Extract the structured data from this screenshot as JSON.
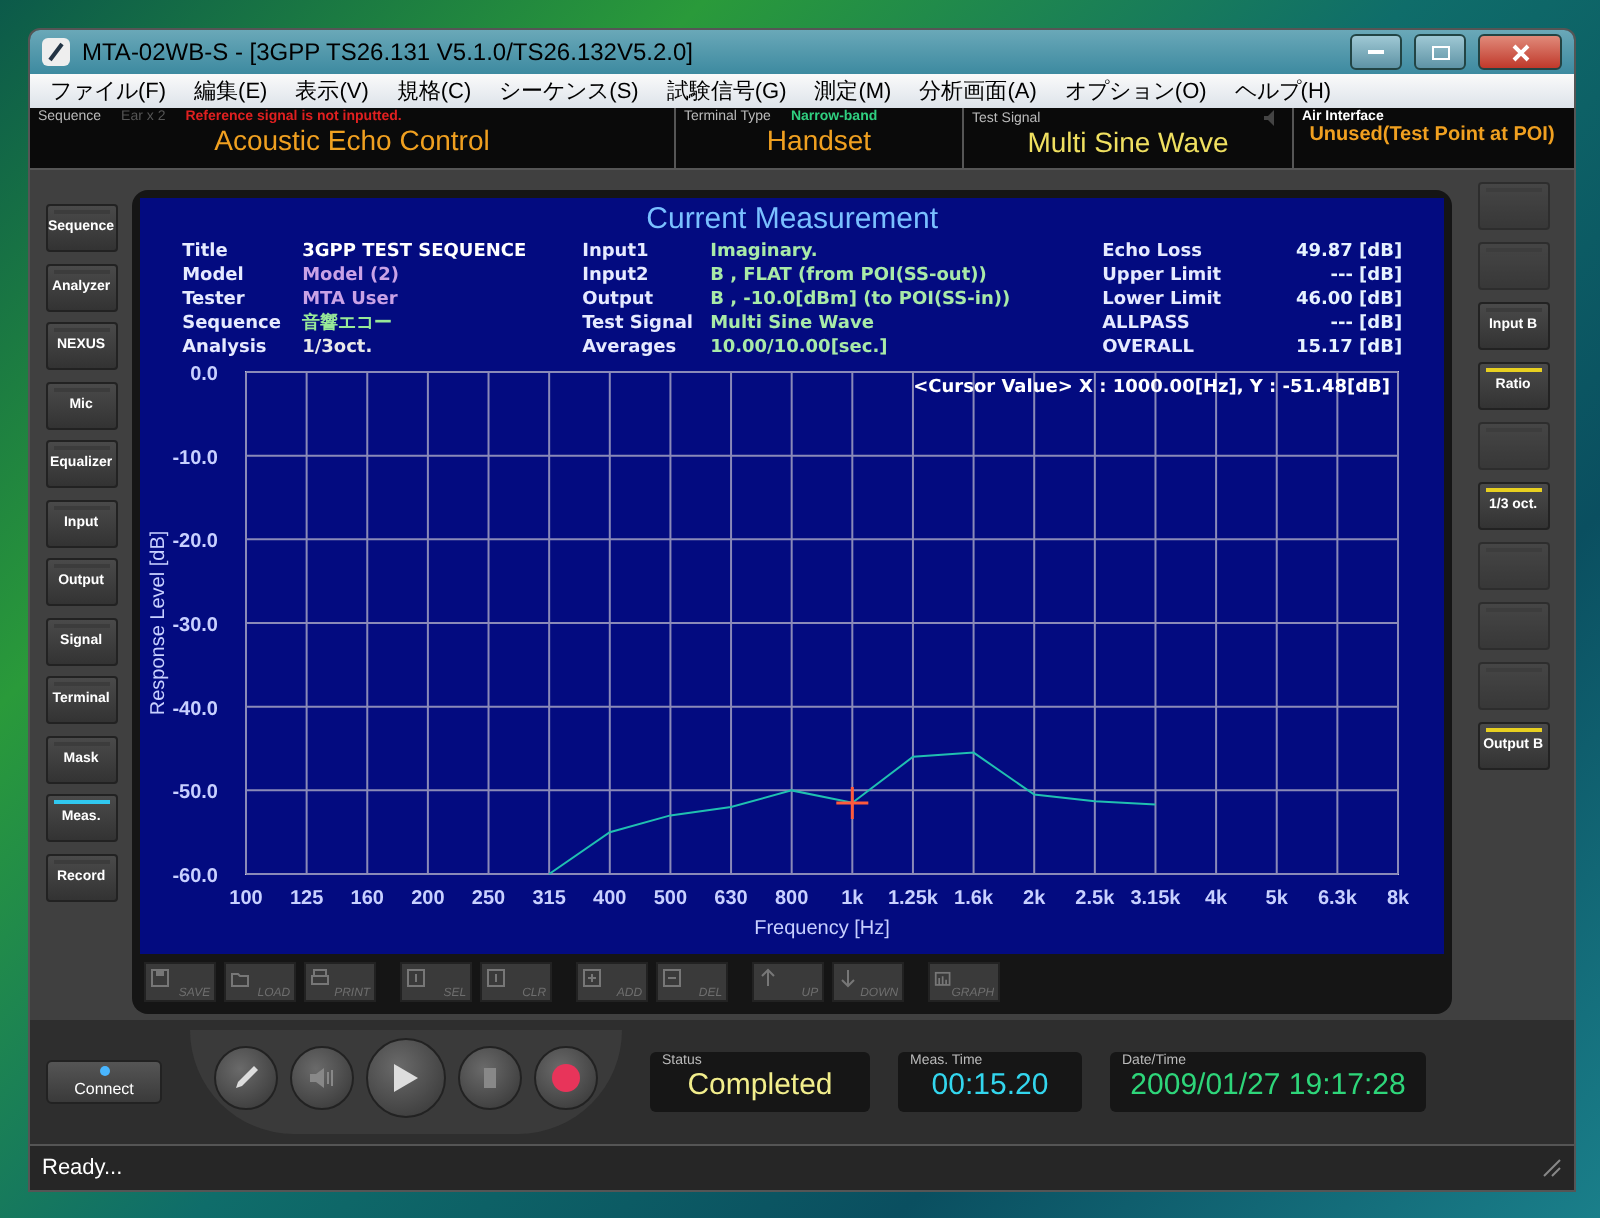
{
  "window": {
    "title": "MTA-02WB-S - [3GPP TS26.131 V5.1.0/TS26.132V5.2.0]"
  },
  "menu": [
    "ファイル(F)",
    "編集(E)",
    "表示(V)",
    "規格(C)",
    "シーケンス(S)",
    "試験信号(G)",
    "測定(M)",
    "分析画面(A)",
    "オプション(O)",
    "ヘルプ(H)"
  ],
  "info_strip": {
    "sequence": {
      "label": "Sequence",
      "sub": "Ear x 2",
      "warning": "Reference signal is not inputted.",
      "value": "Acoustic Echo Control"
    },
    "terminal": {
      "label": "Terminal Type",
      "sub": "Narrow-band",
      "value": "Handset"
    },
    "signal": {
      "label": "Test Signal",
      "value": "Multi Sine Wave"
    },
    "air": {
      "label": "Air Interface",
      "value": "Unused(Test Point at POI)"
    }
  },
  "left_buttons": [
    {
      "label": "Sequence",
      "lit": false
    },
    {
      "label": "Analyzer",
      "lit": false
    },
    {
      "label": "NEXUS",
      "lit": false
    },
    {
      "label": "Mic",
      "lit": false
    },
    {
      "label": "Equalizer",
      "lit": false
    },
    {
      "label": "Input",
      "lit": false
    },
    {
      "label": "Output",
      "lit": false
    },
    {
      "label": "Signal",
      "lit": false
    },
    {
      "label": "Terminal",
      "lit": false
    },
    {
      "label": "Mask",
      "lit": false
    },
    {
      "label": "Meas.",
      "lit": true
    },
    {
      "label": "Record",
      "lit": false
    }
  ],
  "right_buttons": [
    {
      "kind": "blank",
      "lit": false
    },
    {
      "kind": "blank",
      "lit": false
    },
    {
      "kind": "labeled",
      "label": "Input B",
      "lit": false
    },
    {
      "kind": "labeled",
      "label": "Ratio",
      "lit": true
    },
    {
      "kind": "blank",
      "lit": false
    },
    {
      "kind": "labeled",
      "label": "1/3 oct.",
      "lit": true
    },
    {
      "kind": "blank",
      "lit": false
    },
    {
      "kind": "blank",
      "lit": false
    },
    {
      "kind": "blank",
      "lit": false
    },
    {
      "kind": "labeled",
      "label": "Output B",
      "lit": true
    }
  ],
  "measurement": {
    "title": "Current Measurement",
    "info": [
      [
        {
          "label": "Title",
          "value": "3GPP TEST SEQUENCE",
          "color": "#ffffff"
        },
        {
          "label": "Model",
          "value": "Model (2)",
          "color": "#c9a2e6"
        },
        {
          "label": "Tester",
          "value": "MTA User",
          "color": "#c9a2e6"
        },
        {
          "label": "Sequence",
          "value": "音響エコー",
          "color": "#98e898"
        },
        {
          "label": "Analysis",
          "value": "1/3oct.",
          "color": "#e8e8e8"
        }
      ],
      [
        {
          "label": "Input1",
          "value": "Imaginary.",
          "color": "#a8eaa8"
        },
        {
          "label": "Input2",
          "value": "B , FLAT (from POI(SS-out))",
          "color": "#a8eaa8"
        },
        {
          "label": "Output",
          "value": "B , -10.0[dBm] (to POI(SS-in))",
          "color": "#a8eaa8"
        },
        {
          "label": "Test Signal",
          "value": "Multi Sine Wave",
          "color": "#a8eaa8"
        },
        {
          "label": "Averages",
          "value": "10.00/10.00[sec.]",
          "color": "#a8eaa8"
        }
      ],
      [
        {
          "label": "Echo Loss",
          "value": "49.87 [dB]",
          "color": "#e6f2ff"
        },
        {
          "label": "Upper Limit",
          "value": "--- [dB]",
          "color": "#e6f2ff"
        },
        {
          "label": "Lower Limit",
          "value": "46.00 [dB]",
          "color": "#e6f2ff"
        },
        {
          "label": "ALLPASS",
          "value": "--- [dB]",
          "color": "#e6f2ff"
        },
        {
          "label": "OVERALL",
          "value": "15.17 [dB]",
          "color": "#e6f2ff"
        }
      ]
    ],
    "cursor": "<Cursor Value> X : 1000.00[Hz], Y : -51.48[dB]",
    "chart_data": {
      "type": "line",
      "xlabel": "Frequency [Hz]",
      "ylabel": "Response Level [dB]",
      "categories": [
        "100",
        "125",
        "160",
        "200",
        "250",
        "315",
        "400",
        "500",
        "630",
        "800",
        "1k",
        "1.25k",
        "1.6k",
        "2k",
        "2.5k",
        "3.15k",
        "4k",
        "5k",
        "6.3k",
        "8k"
      ],
      "grid": true,
      "series": [
        {
          "color": "#20c0b0",
          "values": [
            null,
            null,
            null,
            null,
            null,
            -60,
            -55,
            -53,
            -52,
            -50,
            -51.5,
            -46,
            -45.5,
            -50.5,
            -51.3,
            -51.7,
            null,
            null,
            null,
            null
          ]
        }
      ],
      "ylim": [
        -60,
        0
      ],
      "yticks": [
        {
          "value": 0,
          "label": "0.0"
        },
        {
          "value": -10,
          "label": "-10.0"
        },
        {
          "value": -20,
          "label": "-20.0"
        },
        {
          "value": -30,
          "label": "-30.0"
        },
        {
          "value": -40,
          "label": "-40.0"
        },
        {
          "value": -50,
          "label": "-50.0"
        },
        {
          "value": -60,
          "label": "-60.0"
        }
      ]
    }
  },
  "toolbar": [
    {
      "label": "SAVE",
      "disabled": true
    },
    {
      "label": "LOAD",
      "disabled": true
    },
    {
      "label": "PRINT",
      "disabled": true
    },
    {
      "label": "SEL",
      "disabled": true
    },
    {
      "label": "CLR",
      "disabled": true
    },
    {
      "label": "ADD",
      "disabled": true
    },
    {
      "label": "DEL",
      "disabled": true
    },
    {
      "label": "UP",
      "disabled": true
    },
    {
      "label": "DOWN",
      "disabled": true
    },
    {
      "label": "GRAPH",
      "disabled": true
    }
  ],
  "connect": {
    "label": "Connect",
    "led": true
  },
  "transport": [
    {
      "kind": "mic",
      "disabled": false
    },
    {
      "kind": "speaker",
      "disabled": true
    },
    {
      "kind": "play",
      "disabled": false
    },
    {
      "kind": "stop",
      "disabled": true
    },
    {
      "kind": "record",
      "disabled": false
    }
  ],
  "readouts": [
    {
      "label": "Status",
      "value": "Completed",
      "color": "#f2ee8c"
    },
    {
      "label": "Meas. Time",
      "value": "00:15.20",
      "color": "#33d6ee"
    },
    {
      "label": "Date/Time",
      "value": "2009/01/27 19:17:28",
      "color": "#2ed67a"
    }
  ],
  "status_bar": "Ready..."
}
